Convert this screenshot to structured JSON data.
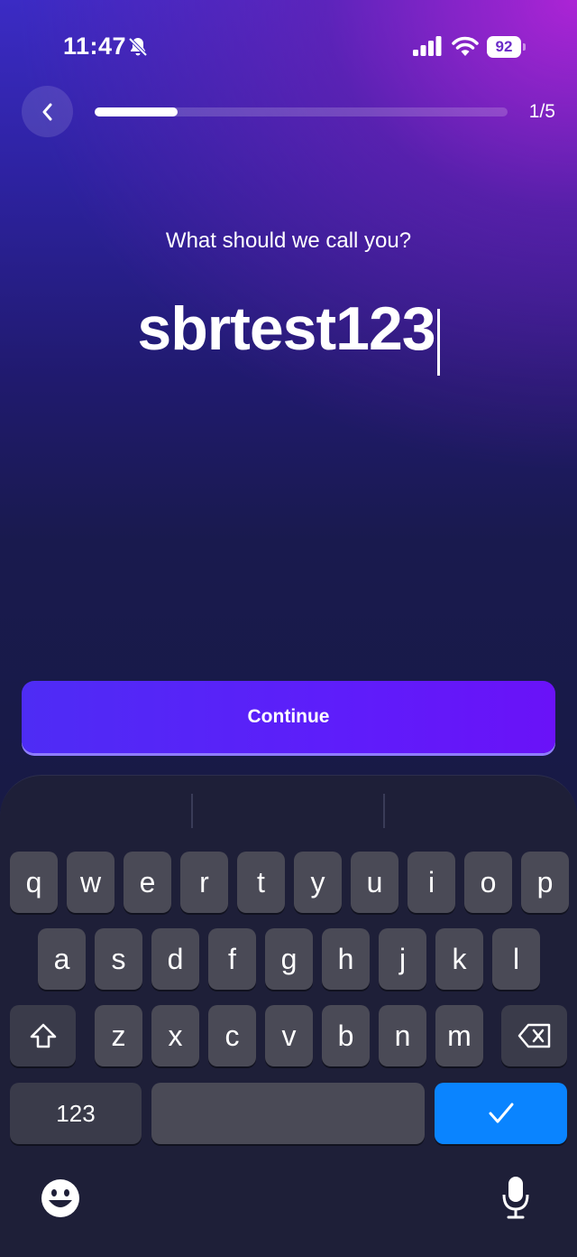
{
  "status_bar": {
    "time": "11:47",
    "battery": "92"
  },
  "nav": {
    "progress": 0.2,
    "step_label": "1/5"
  },
  "main": {
    "prompt": "What should we call you?",
    "name_value": "sbrtest123"
  },
  "continue_label": "Continue",
  "keyboard": {
    "row1": [
      "q",
      "w",
      "e",
      "r",
      "t",
      "y",
      "u",
      "i",
      "o",
      "p"
    ],
    "row2": [
      "a",
      "s",
      "d",
      "f",
      "g",
      "h",
      "j",
      "k",
      "l"
    ],
    "row3": [
      "z",
      "x",
      "c",
      "v",
      "b",
      "n",
      "m"
    ],
    "numbers_label": "123",
    "done_icon": "checkmark-icon"
  },
  "colors": {
    "accent": "#5b22f8",
    "done_key": "#0a84ff",
    "keyboard_bg": "#1e1f38"
  }
}
